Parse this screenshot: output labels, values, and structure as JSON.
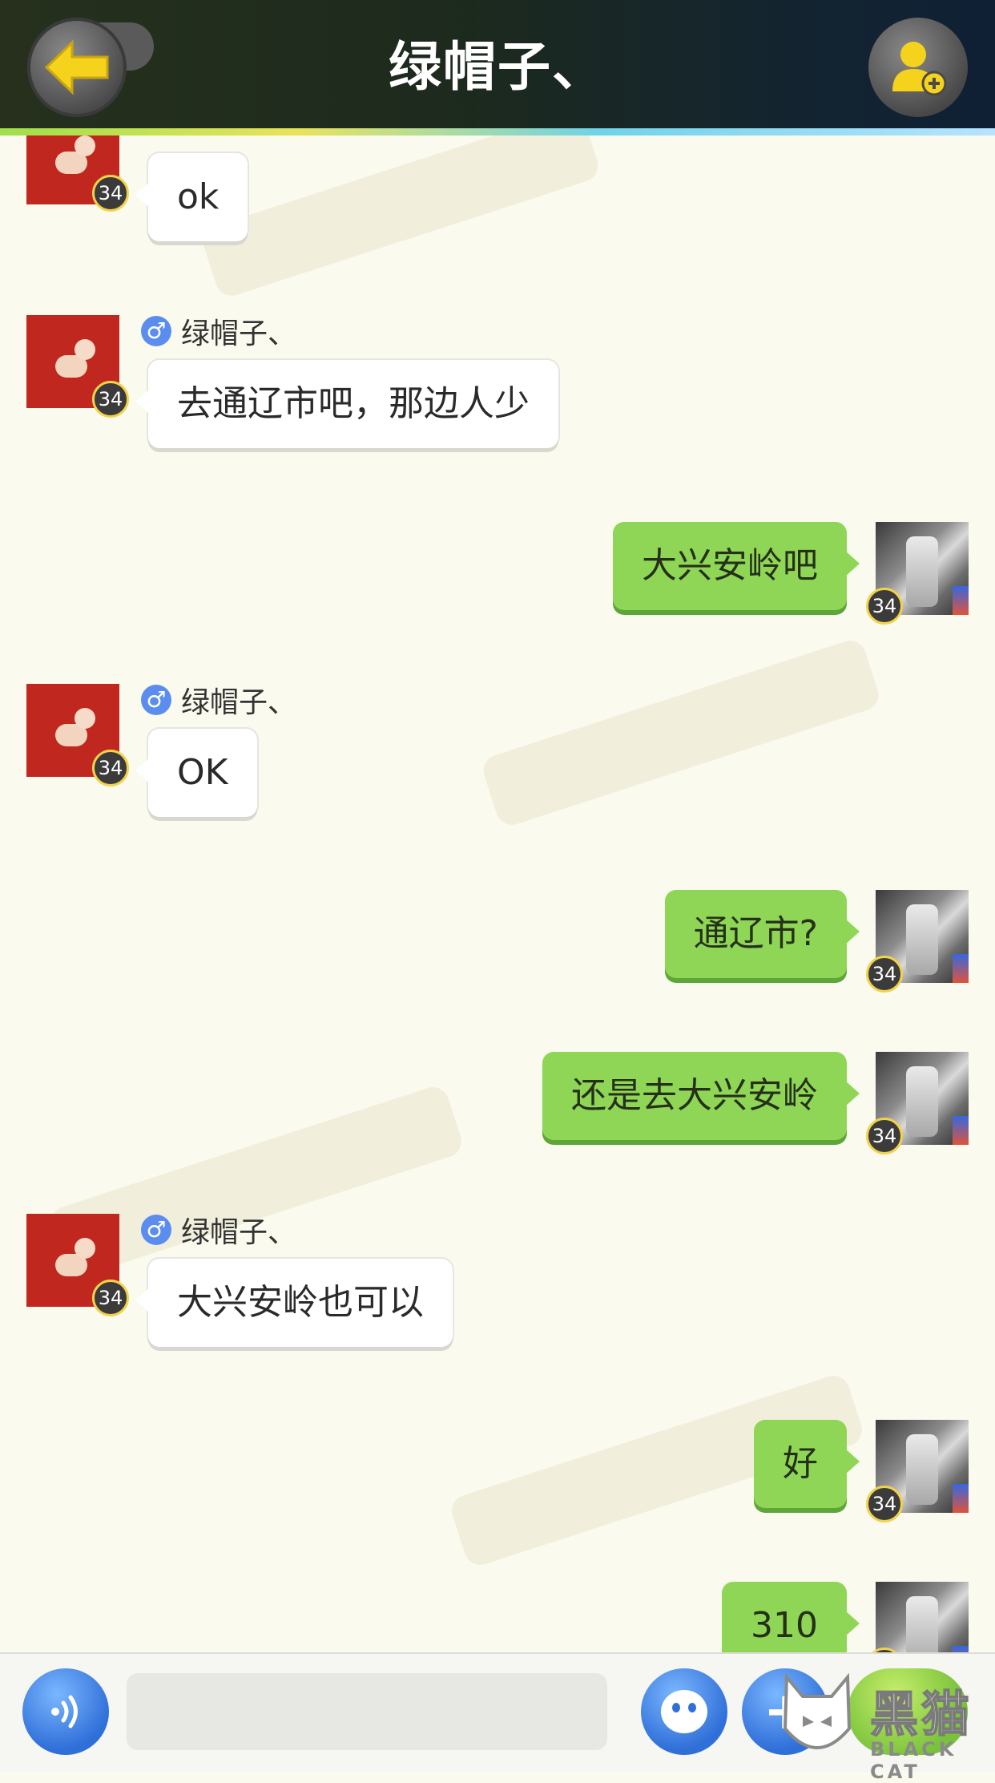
{
  "header": {
    "title": "绿帽子、",
    "back_icon": "back-arrow-icon",
    "add_friend_icon": "add-friend-icon",
    "accent_color": "#f5d21c"
  },
  "messages": [
    {
      "side": "left",
      "level": "34",
      "sender": "",
      "text": "ok"
    },
    {
      "side": "left",
      "level": "34",
      "sender": "绿帽子、",
      "text": "去通辽市吧，那边人少"
    },
    {
      "side": "right",
      "level": "34",
      "text": "大兴安岭吧"
    },
    {
      "side": "left",
      "level": "34",
      "sender": "绿帽子、",
      "text": "OK"
    },
    {
      "side": "right",
      "level": "34",
      "text": "通辽市?"
    },
    {
      "side": "right",
      "level": "34",
      "text": "还是去大兴安岭"
    },
    {
      "side": "left",
      "level": "34",
      "sender": "绿帽子、",
      "text": "大兴安岭也可以"
    },
    {
      "side": "right",
      "level": "34",
      "text": "好"
    },
    {
      "side": "right",
      "level": "34",
      "text": "310"
    }
  ],
  "gender_symbol": "♂",
  "input": {
    "value": "",
    "placeholder": ""
  },
  "watermark": {
    "text": "黑猫",
    "sub": "BLACK CAT"
  },
  "colors": {
    "my_bubble": "#8fd656",
    "other_bubble": "#ffffff",
    "background": "#fbfaee",
    "button_blue": "#2f6fd8"
  }
}
